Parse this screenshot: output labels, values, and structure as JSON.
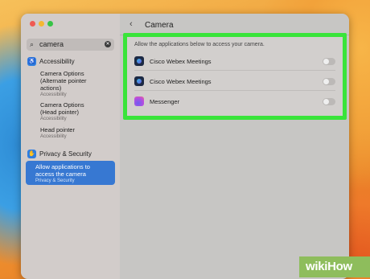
{
  "window": {
    "sidebar": {
      "search": {
        "value": "camera"
      },
      "sections": [
        {
          "label": "Accessibility",
          "icon": "accessibility-icon"
        },
        {
          "label": "Privacy & Security",
          "icon": "hand-icon"
        }
      ],
      "items": [
        {
          "title_line1": "Camera Options",
          "title_line2": "(Alternate pointer",
          "title_line3": "actions)",
          "sub": "Accessibility"
        },
        {
          "title_line1": "Camera Options",
          "title_line2": "(Head pointer)",
          "sub": "Accessibility"
        },
        {
          "title_line1": "Head pointer",
          "sub": "Accessibility"
        }
      ],
      "selected": {
        "line1": "Allow applications to",
        "line2": "access the camera",
        "sub": "Privacy & Security"
      }
    },
    "main": {
      "title": "Camera",
      "header_text": "Allow the applications below to access your camera.",
      "apps": [
        {
          "name": "Cisco Webex Meetings",
          "icon": "webex-icon",
          "enabled": false
        },
        {
          "name": "Cisco Webex Meetings",
          "icon": "webex-icon",
          "enabled": false
        },
        {
          "name": "Messenger",
          "icon": "messenger-icon",
          "enabled": false
        }
      ]
    }
  },
  "watermark": "wikiHow",
  "colors": {
    "highlight": "#39e43a",
    "selection": "#3778d2"
  }
}
